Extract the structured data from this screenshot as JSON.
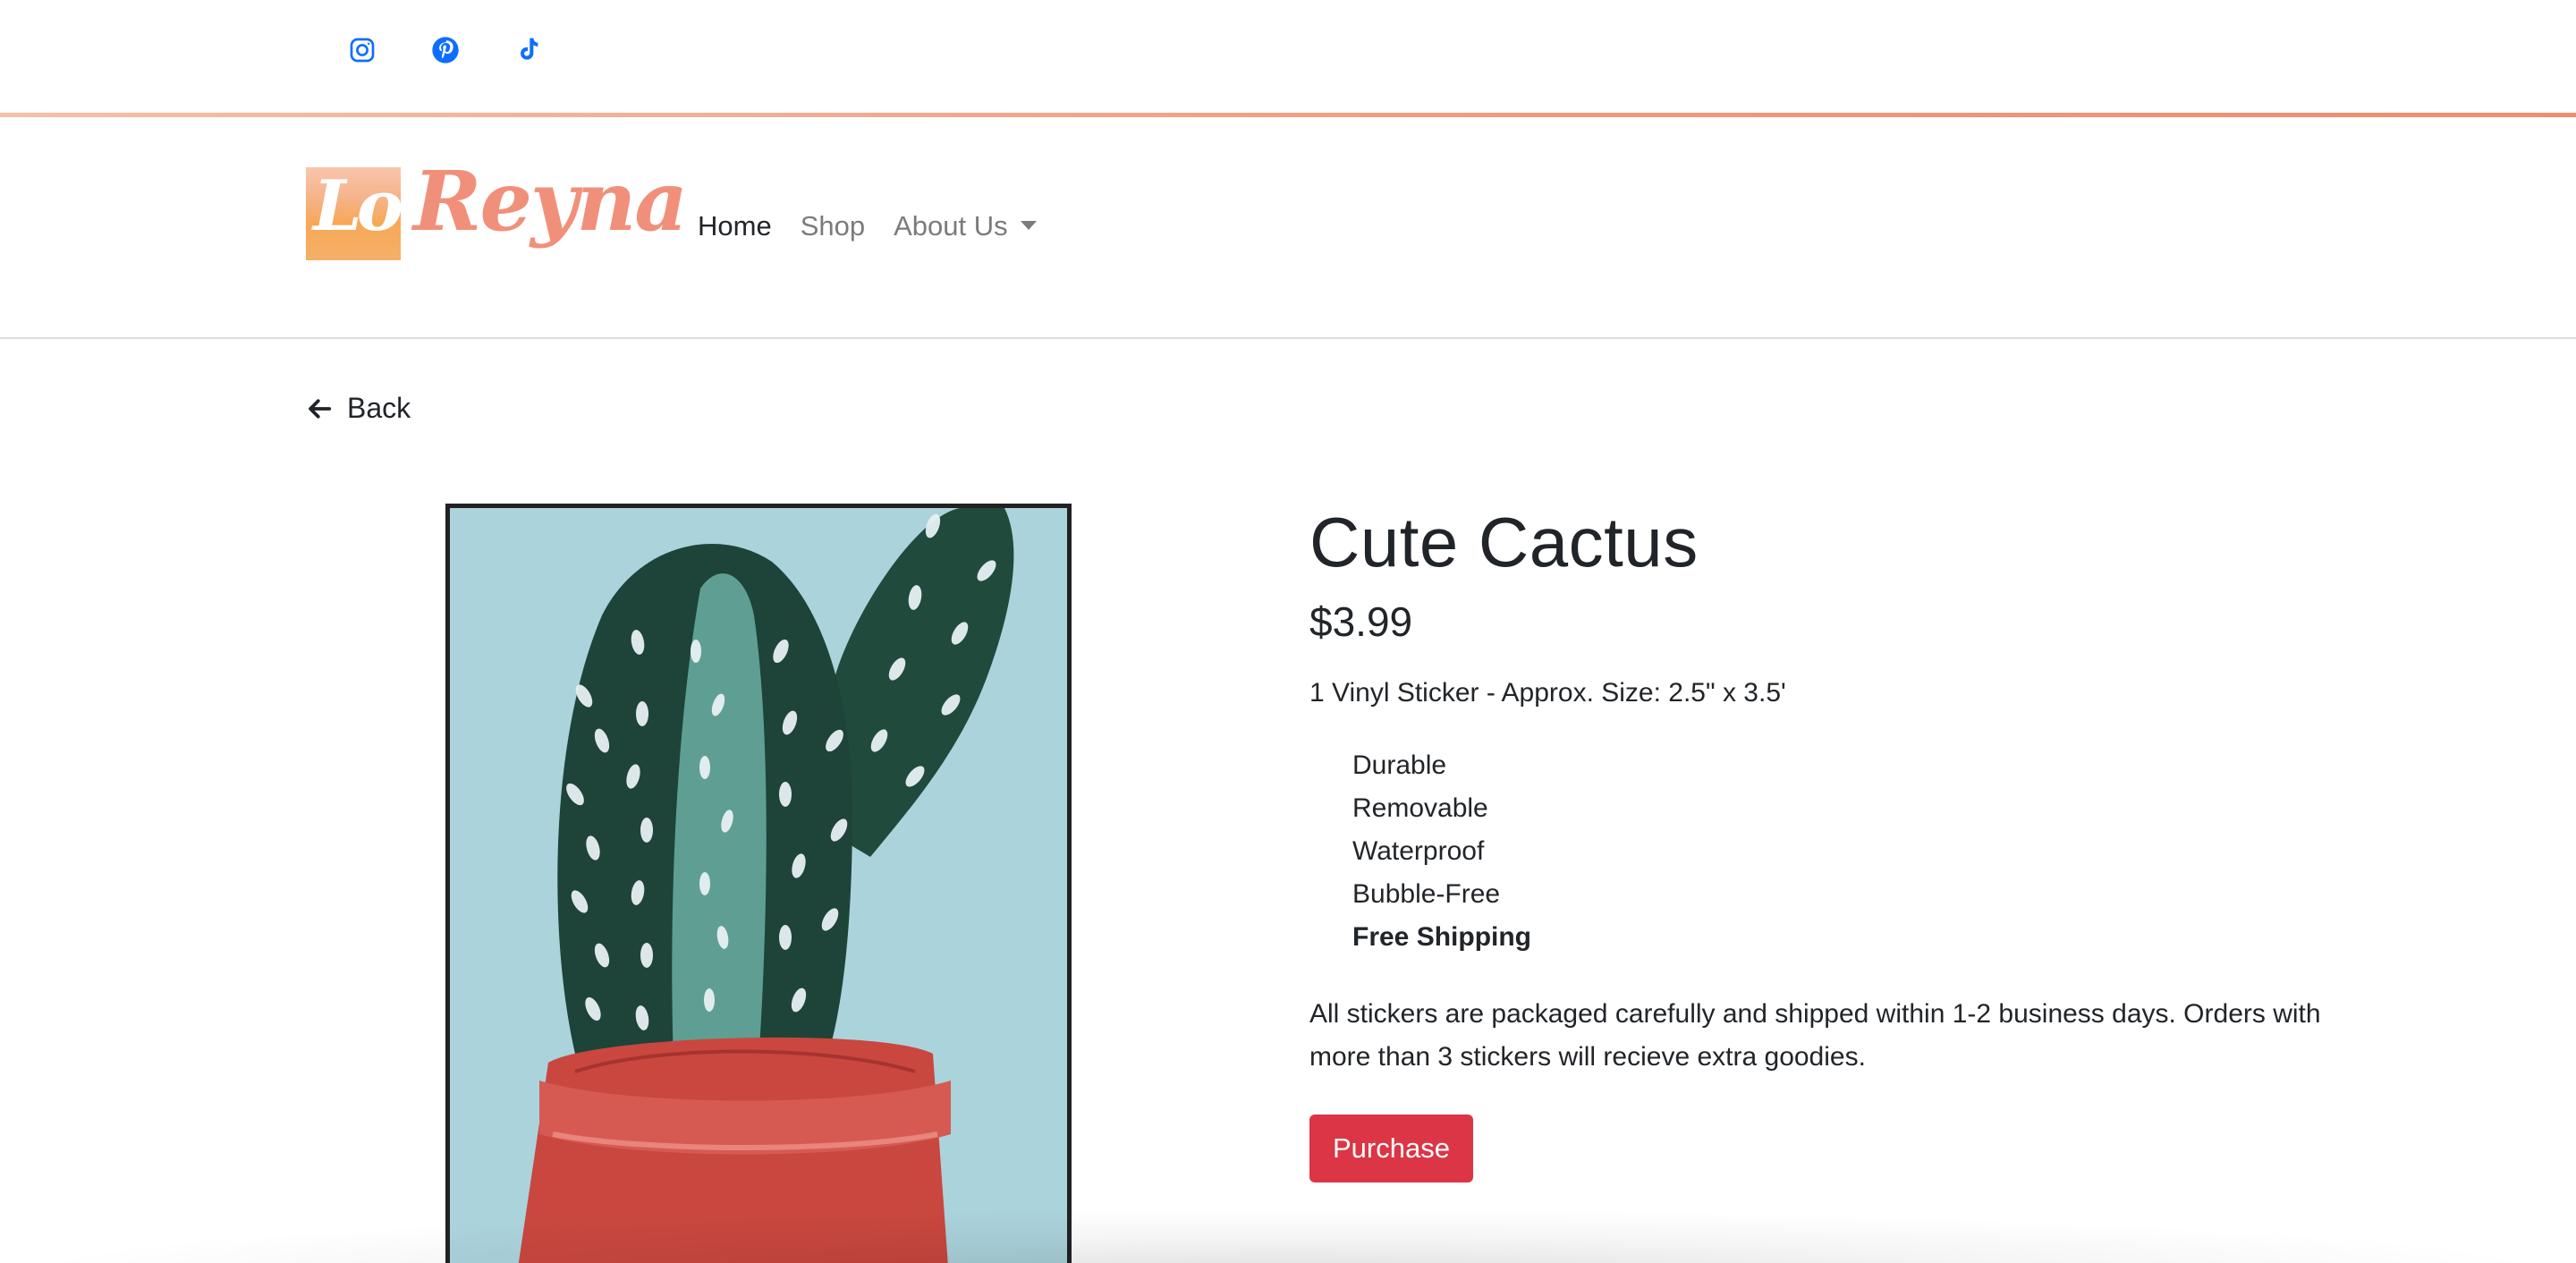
{
  "social": {
    "icons": [
      "instagram-icon",
      "pinterest-icon",
      "tiktok-icon"
    ],
    "color": "#0d6efd"
  },
  "brand": {
    "logo_text_lo": "Lo",
    "logo_text_reyna": "Reyna"
  },
  "nav": {
    "items": [
      {
        "label": "Home",
        "active": true
      },
      {
        "label": "Shop",
        "active": false
      },
      {
        "label": "About Us",
        "active": false,
        "dropdown": true
      }
    ]
  },
  "back": {
    "label": "Back"
  },
  "product": {
    "title": "Cute Cactus",
    "price": "$3.99",
    "description": "1 Vinyl Sticker - Approx. Size: 2.5\" x 3.5'",
    "features": [
      "Durable",
      "Removable",
      "Waterproof",
      "Bubble-Free",
      "Free Shipping"
    ],
    "shipping_note": "All stickers are packaged carefully and shipped within 1-2 business days. Orders with more than 3 stickers will recieve extra goodies.",
    "purchase_label": "Purchase"
  },
  "colors": {
    "accent_line": "#ef9a7d",
    "purchase_button": "#dc3545",
    "image_background": "#abd3dc",
    "cactus_dark": "#1f4a3c",
    "cactus_light": "#5f9f93",
    "pot": "#c9473f"
  }
}
